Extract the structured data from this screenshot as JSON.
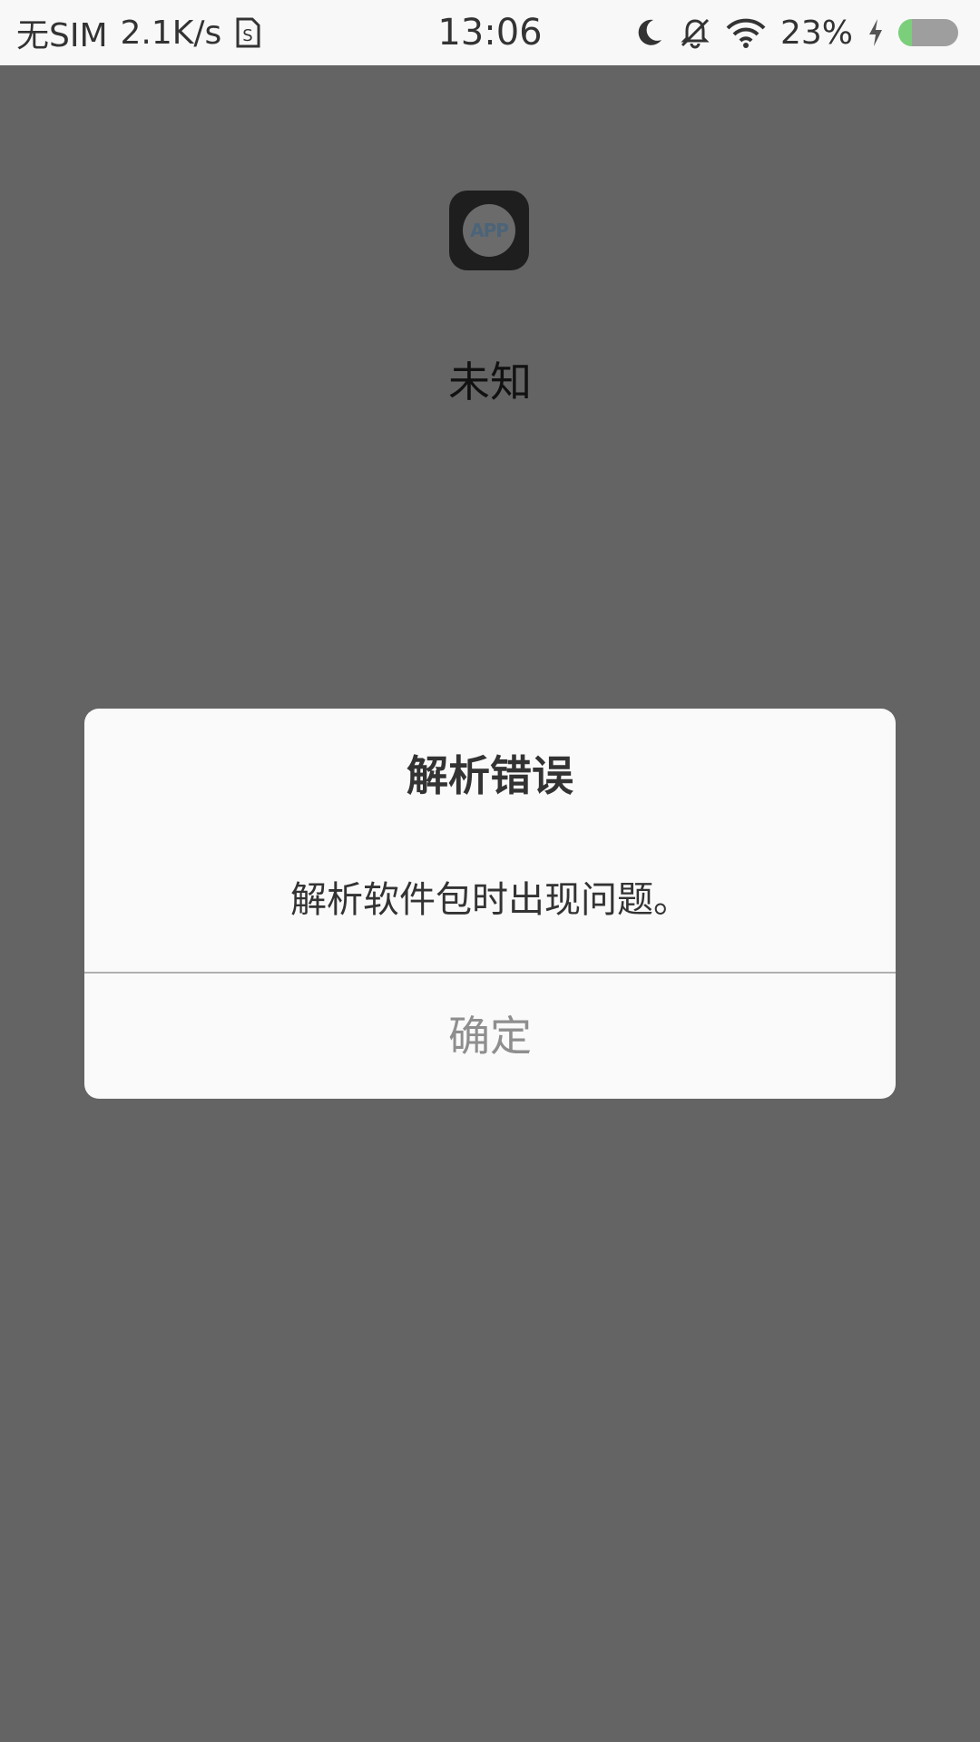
{
  "status_bar": {
    "carrier": "无SIM",
    "speed": "2.1K/s",
    "time": "13:06",
    "battery_percent": "23%",
    "battery_level": 0.23,
    "icons": [
      "sim-card-icon",
      "moon-icon",
      "bell-off-icon",
      "wifi-icon",
      "charging-bolt-icon",
      "battery-icon"
    ]
  },
  "app": {
    "icon_label": "APP",
    "name": "未知"
  },
  "dialog": {
    "title": "解析错误",
    "message": "解析软件包时出现问题。",
    "confirm_label": "确定"
  },
  "colors": {
    "background": "#646464",
    "status_bar": "#f8f8f8",
    "dialog": "#fafafa",
    "battery_charge": "#7bcf7b",
    "button_text": "#8e8e8e"
  }
}
